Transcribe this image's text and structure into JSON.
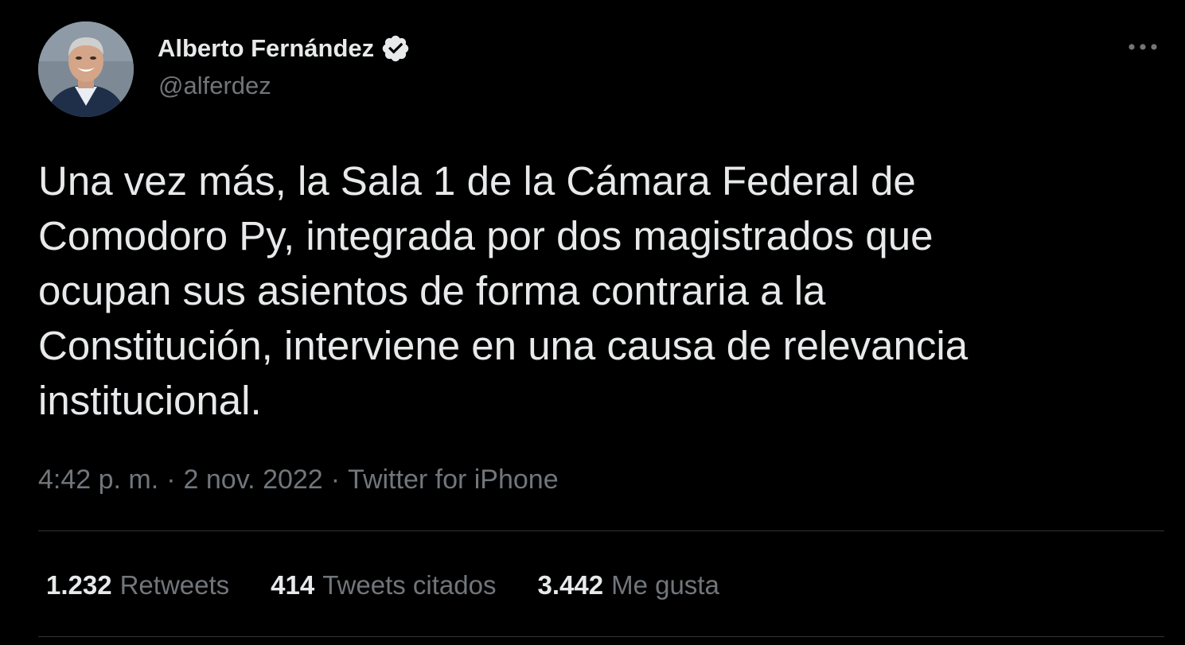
{
  "author": {
    "name": "Alberto Fernández",
    "handle": "@alferdez",
    "verified": true,
    "avatar_icon": "profile-photo"
  },
  "tweet": {
    "text": "Una vez más, la Sala 1 de la Cámara Federal de\nComodoro Py, integrada por dos magistrados que\nocupan sus asientos de forma contraria a la\nConstitución, interviene en una causa de relevancia\ninstitucional.",
    "time": "4:42 p. m.",
    "date": "2 nov. 2022",
    "source": "Twitter for iPhone",
    "separator": "·"
  },
  "stats": {
    "retweets": {
      "count": "1.232",
      "label": "Retweets"
    },
    "quotes": {
      "count": "414",
      "label": "Tweets citados"
    },
    "likes": {
      "count": "3.442",
      "label": "Me gusta"
    }
  },
  "icons": {
    "more": "more-horizontal-icon",
    "verified": "verified-badge-icon"
  },
  "colors": {
    "background": "#000000",
    "text_primary": "#e7e9ea",
    "text_secondary": "#71767b",
    "divider": "#2f3336"
  }
}
